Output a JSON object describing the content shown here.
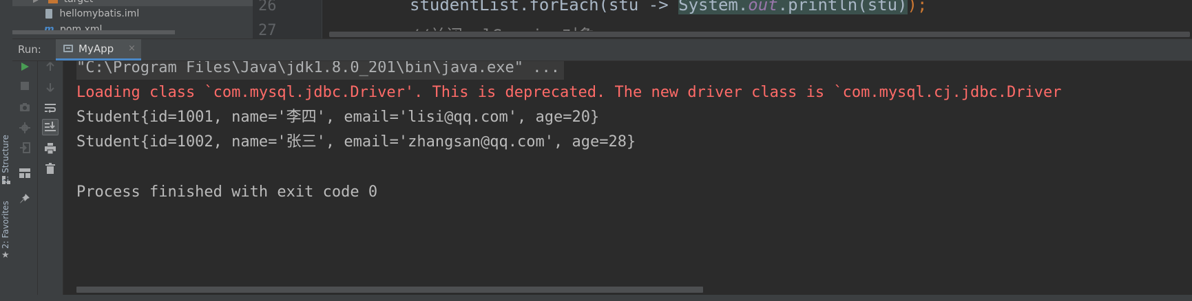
{
  "left_strip": {
    "structure_tab": "Z: Structure",
    "favorites_tab": "2: Favorites",
    "structure_icon": "structure-icon",
    "favorites_icon": "star-icon"
  },
  "project_tree": {
    "items": [
      {
        "label": "target",
        "icon": "folder-icon"
      },
      {
        "label": "hellomybatis.iml",
        "icon": "iml-file-icon"
      },
      {
        "label": "pom.xml",
        "icon": "maven-icon"
      }
    ]
  },
  "editor": {
    "line_numbers": [
      "26",
      "27"
    ],
    "line_26": {
      "prefix": "studentList.forEach(stu -> ",
      "class_name": "System.",
      "field": "out",
      "suffix": ".println(stu)",
      "end": ");"
    },
    "line_27": "//关闭sqlSession对象"
  },
  "run_panel": {
    "label": "Run:",
    "tab_name": "MyApp",
    "tab_close": "×",
    "tab_icon": "console-window-icon"
  },
  "toolbar_1": {
    "buttons": [
      "rerun-icon",
      "stop-icon",
      "camera-icon",
      "debug-settings-icon",
      "login-icon",
      "layout-icon",
      "pin-icon"
    ]
  },
  "toolbar_2": {
    "buttons": [
      "up-arrow-icon",
      "down-arrow-icon",
      "soft-wrap-icon",
      "scroll-to-end-icon",
      "print-icon",
      "trash-icon"
    ]
  },
  "console": {
    "command": "\"C:\\Program Files\\Java\\jdk1.8.0_201\\bin\\java.exe\" ...",
    "warning": "Loading class `com.mysql.jdbc.Driver'. This is deprecated. The new driver class is `com.mysql.cj.jdbc.Driver",
    "output": [
      "Student{id=1001, name='李四', email='lisi@qq.com', age=20}",
      "Student{id=1002, name='张三', email='zhangsan@qq.com', age=28}"
    ],
    "exit": "Process finished with exit code 0"
  },
  "colors": {
    "background": "#2b2b2b",
    "panel": "#3c3f41",
    "warning_text": "#ff6b68",
    "output_text": "#bbbbbb",
    "run_green": "#499c54",
    "keyword_orange": "#cc7832",
    "static_field_purple": "#9876aa"
  }
}
